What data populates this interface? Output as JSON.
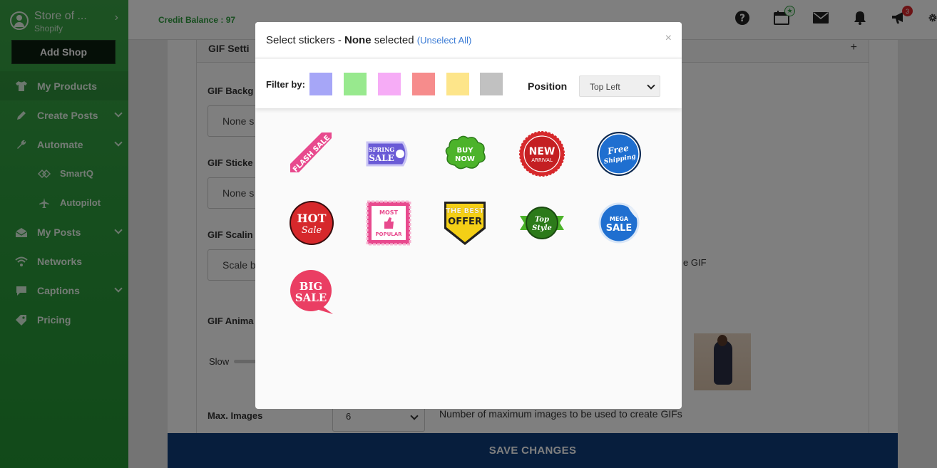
{
  "sidebar": {
    "store_name": "Store of ...",
    "store_platform": "Shopify",
    "add_shop": "Add Shop",
    "items": [
      {
        "label": "My Products"
      },
      {
        "label": "Create Posts"
      },
      {
        "label": "Automate"
      },
      {
        "label": "SmartQ"
      },
      {
        "label": "Autopilot"
      },
      {
        "label": "My Posts"
      },
      {
        "label": "Networks"
      },
      {
        "label": "Captions"
      },
      {
        "label": "Pricing"
      }
    ]
  },
  "topbar": {
    "credit": "Credit Balance : 97",
    "calendar_badge": "★",
    "announce_badge": "3"
  },
  "background": {
    "panel_title": "GIF Setti",
    "panel_plus": "+",
    "bg_label": "GIF Backg",
    "bg_value": "None s",
    "sticker_label": "GIF Sticke",
    "sticker_value": "None s",
    "scaling_label": "GIF Scalin",
    "scaling_value": "Scale b",
    "scaling_note": "e GIF",
    "anim_label": "GIF Anima",
    "slow": "Slow",
    "max_label": "Max. Images",
    "max_value": "6",
    "max_note": "Number of maximum images to be used to create GIFs",
    "save": "SAVE CHANGES"
  },
  "modal": {
    "title_prefix": "Select stickers - ",
    "title_bold": "None",
    "title_suffix": " selected ",
    "unselect": "(Unselect All)",
    "close": "×",
    "filter_label": "Filter by:",
    "swatches": [
      "#a6a6f7",
      "#98e98e",
      "#f6acf6",
      "#f68c8c",
      "#fde58a",
      "#c1c1c1"
    ],
    "position_label": "Position",
    "position_value": "Top Left",
    "stickers": [
      {
        "line1": "FLASH SALE",
        "line2": "",
        "color": "#e84a8e"
      },
      {
        "line1": "SPRING",
        "line2": "SALE",
        "color": "#6a5bd6"
      },
      {
        "line1": "BUY",
        "line2": "NOW",
        "color": "#4cb32a"
      },
      {
        "line1": "NEW",
        "line2": "ARRIVAL",
        "color": "#d6282b"
      },
      {
        "line1": "Free",
        "line2": "Shipping",
        "color": "#1f6fd0"
      },
      {
        "line1": "HOT",
        "line2": "Sale",
        "color": "#d6282b"
      },
      {
        "line1": "MOST",
        "line2": "POPULAR",
        "color": "#e84a8e"
      },
      {
        "line1": "THE BEST",
        "line2": "OFFER",
        "color": "#f4cf16"
      },
      {
        "line1": "Top",
        "line2": "Style",
        "color": "#2c7a1a"
      },
      {
        "line1": "MEGA",
        "line2": "SALE",
        "color": "#1f6fd0"
      },
      {
        "line1": "BIG",
        "line2": "SALE",
        "color": "#ea3e63"
      }
    ]
  }
}
